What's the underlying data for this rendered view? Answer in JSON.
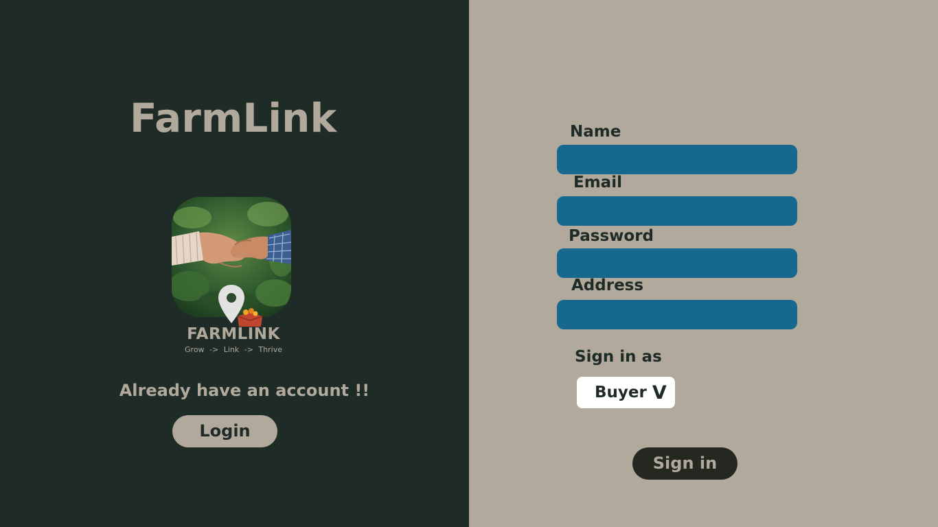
{
  "left": {
    "title": "FarmLink",
    "logo": {
      "wordmark": "FARMLINK",
      "tagline": "Grow  ->  Link  ->  Thrive"
    },
    "account_text": "Already have an account !!",
    "login_label": "Login"
  },
  "form": {
    "name_label": "Name",
    "name_value": "",
    "email_label": "Email",
    "email_value": "",
    "password_label": "Password",
    "password_value": "",
    "address_label": "Address",
    "address_value": "",
    "signin_as_label": "Sign in as",
    "role_selected": "Buyer",
    "role_chevron": "V",
    "signin_label": "Sign in"
  },
  "colors": {
    "left_bg": "#1f2b27",
    "right_bg": "#b2a99d",
    "input_bg": "#16688f",
    "signin_bg": "#252820"
  },
  "icons": {
    "logo_image": "handshake-photo",
    "pin": "location-pin-icon",
    "box": "produce-box-icon",
    "dropdown": "chevron-down-icon"
  }
}
